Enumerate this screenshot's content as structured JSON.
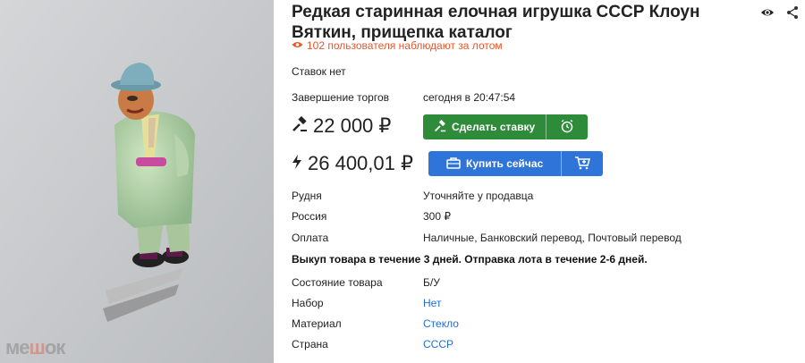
{
  "title": "Редкая старинная елочная игрушка СССР Клоун Вяткин, прищепка каталог",
  "watchers": "102 пользователя наблюдают за лотом",
  "bids": "Ставок нет",
  "end": {
    "label": "Завершение торгов",
    "value": "сегодня в 20:47:54"
  },
  "current_price": "22 000 ₽",
  "bid_button": "Сделать ставку",
  "buy_price": "26 400,01 ₽",
  "buy_button": "Купить сейчас",
  "specs_top": [
    {
      "label": "Рудня",
      "value": "Уточняйте у продавца"
    },
    {
      "label": "Россия",
      "value": "300 ₽"
    },
    {
      "label": "Оплата",
      "value": "Наличные, Банковский перевод, Почтовый перевод"
    }
  ],
  "note": "Выкуп товара в течение 3 дней. Отправка лота в течение 2-6 дней.",
  "specs_bottom": [
    {
      "label": "Состояние товара",
      "value": "Б/У"
    },
    {
      "label": "Набор",
      "value": "Нет"
    },
    {
      "label": "Материал",
      "value": "Стекло"
    },
    {
      "label": "Страна",
      "value": "СССР"
    }
  ],
  "watermark": "мешок",
  "icons": {
    "view": "eye-icon",
    "share": "share-icon",
    "hammer": "gavel-icon",
    "lightning": "lightning-icon",
    "alarm": "alarm-clock-icon",
    "briefcase": "briefcase-icon",
    "cart": "cart-add-icon"
  },
  "colors": {
    "green": "#2e8b3a",
    "blue": "#2f74d8",
    "orange": "#e8562a",
    "link": "#1d6fd8"
  }
}
